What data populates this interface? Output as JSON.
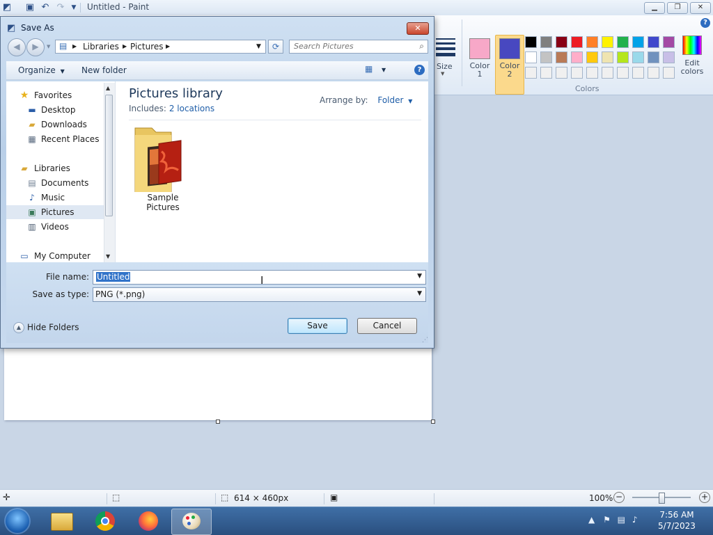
{
  "paint": {
    "title": "Untitled - Paint",
    "ribbon": {
      "size_label": "Size",
      "color1_label": "Color\n1",
      "color2_label": "Color\n2",
      "edit_colors_label": "Edit\ncolors",
      "colors_group_label": "Colors",
      "color1": "#f7a8c8",
      "color2": "#4848c0",
      "palette_row1": [
        "#000000",
        "#7f7f7f",
        "#880015",
        "#ed1c24",
        "#ff7f27",
        "#fff200",
        "#22b14c",
        "#00a2e8",
        "#3f48cc",
        "#a349a4"
      ],
      "palette_row2": [
        "#ffffff",
        "#c3c3c3",
        "#b97a57",
        "#ffaec9",
        "#ffc90e",
        "#efe4b0",
        "#b5e61d",
        "#99d9ea",
        "#7092be",
        "#c8bfe7"
      ],
      "palette_row3": [
        "#f0f0f0",
        "#f0f0f0",
        "#f0f0f0",
        "#f0f0f0",
        "#f0f0f0",
        "#f0f0f0",
        "#f0f0f0",
        "#f0f0f0",
        "#f0f0f0",
        "#f0f0f0"
      ]
    },
    "statusbar": {
      "canvas_size": "614 × 460px",
      "zoom": "100%"
    }
  },
  "dialog": {
    "title": "Save As",
    "address": [
      "Libraries",
      "Pictures"
    ],
    "search_placeholder": "Search Pictures",
    "toolbar": {
      "organize": "Organize",
      "new_folder": "New folder"
    },
    "nav": {
      "favorites": "Favorites",
      "desktop": "Desktop",
      "downloads": "Downloads",
      "recent_places": "Recent Places",
      "libraries": "Libraries",
      "documents": "Documents",
      "music": "Music",
      "pictures": "Pictures",
      "videos": "Videos",
      "my_computer": "My Computer"
    },
    "content": {
      "library_title": "Pictures library",
      "includes_prefix": "Includes:",
      "includes_link": "2 locations",
      "arrange_by_label": "Arrange by:",
      "arrange_by_value": "Folder",
      "folder_name": "Sample Pictures"
    },
    "file_name_label": "File name:",
    "file_name_value": "Untitled",
    "save_as_type_label": "Save as type:",
    "save_as_type_value": "PNG (*.png)",
    "hide_folders": "Hide Folders",
    "save_button": "Save",
    "cancel_button": "Cancel"
  },
  "taskbar": {
    "time": "7:56 AM",
    "date": "5/7/2023"
  }
}
